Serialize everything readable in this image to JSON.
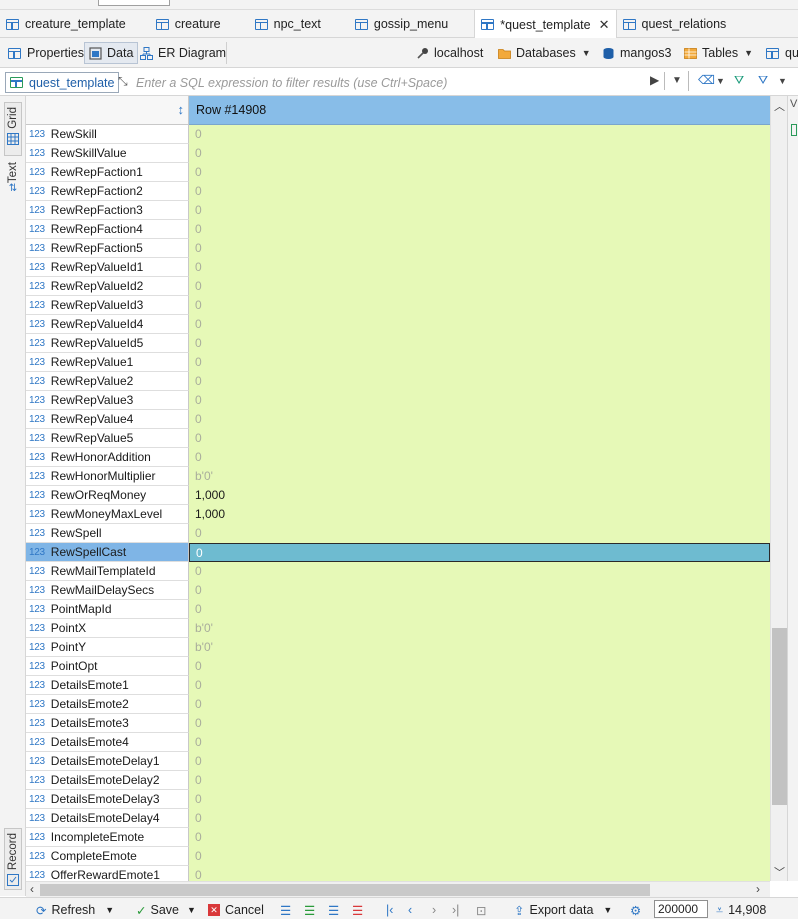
{
  "editor_tabs": [
    {
      "label": "creature_template",
      "active": false
    },
    {
      "label": "creature",
      "active": false
    },
    {
      "label": "npc_text",
      "active": false
    },
    {
      "label": "gossip_menu",
      "active": false
    },
    {
      "label": "*quest_template",
      "active": true
    },
    {
      "label": "quest_relations",
      "active": false
    }
  ],
  "subtoolbar": {
    "properties": "Properties",
    "data": "Data",
    "er_diagram": "ER Diagram",
    "connection": "localhost",
    "databases": "Databases",
    "schema": "mangos3",
    "tables": "Tables",
    "cut_label": "qu"
  },
  "filter": {
    "table": "quest_template",
    "placeholder": "Enter a SQL expression to filter results (use Ctrl+Space)"
  },
  "side_tabs": {
    "grid": "Grid",
    "text": "Text",
    "record": "Record"
  },
  "grid": {
    "header": "Row  #14908",
    "type_badge": "123",
    "selected_index": 22,
    "rows": [
      {
        "name": "RewSkill",
        "value": "0"
      },
      {
        "name": "RewSkillValue",
        "value": "0"
      },
      {
        "name": "RewRepFaction1",
        "value": "0"
      },
      {
        "name": "RewRepFaction2",
        "value": "0"
      },
      {
        "name": "RewRepFaction3",
        "value": "0"
      },
      {
        "name": "RewRepFaction4",
        "value": "0"
      },
      {
        "name": "RewRepFaction5",
        "value": "0"
      },
      {
        "name": "RewRepValueId1",
        "value": "0"
      },
      {
        "name": "RewRepValueId2",
        "value": "0"
      },
      {
        "name": "RewRepValueId3",
        "value": "0"
      },
      {
        "name": "RewRepValueId4",
        "value": "0"
      },
      {
        "name": "RewRepValueId5",
        "value": "0"
      },
      {
        "name": "RewRepValue1",
        "value": "0"
      },
      {
        "name": "RewRepValue2",
        "value": "0"
      },
      {
        "name": "RewRepValue3",
        "value": "0"
      },
      {
        "name": "RewRepValue4",
        "value": "0"
      },
      {
        "name": "RewRepValue5",
        "value": "0"
      },
      {
        "name": "RewHonorAddition",
        "value": "0"
      },
      {
        "name": "RewHonorMultiplier",
        "value": "b'0'"
      },
      {
        "name": "RewOrReqMoney",
        "value": "1,000",
        "strong": true
      },
      {
        "name": "RewMoneyMaxLevel",
        "value": "1,000",
        "strong": true
      },
      {
        "name": "RewSpell",
        "value": "0"
      },
      {
        "name": "RewSpellCast",
        "value": "0"
      },
      {
        "name": "RewMailTemplateId",
        "value": "0"
      },
      {
        "name": "RewMailDelaySecs",
        "value": "0"
      },
      {
        "name": "PointMapId",
        "value": "0"
      },
      {
        "name": "PointX",
        "value": "b'0'"
      },
      {
        "name": "PointY",
        "value": "b'0'"
      },
      {
        "name": "PointOpt",
        "value": "0"
      },
      {
        "name": "DetailsEmote1",
        "value": "0"
      },
      {
        "name": "DetailsEmote2",
        "value": "0"
      },
      {
        "name": "DetailsEmote3",
        "value": "0"
      },
      {
        "name": "DetailsEmote4",
        "value": "0"
      },
      {
        "name": "DetailsEmoteDelay1",
        "value": "0"
      },
      {
        "name": "DetailsEmoteDelay2",
        "value": "0"
      },
      {
        "name": "DetailsEmoteDelay3",
        "value": "0"
      },
      {
        "name": "DetailsEmoteDelay4",
        "value": "0"
      },
      {
        "name": "IncompleteEmote",
        "value": "0"
      },
      {
        "name": "CompleteEmote",
        "value": "0"
      },
      {
        "name": "OfferRewardEmote1",
        "value": "0"
      }
    ]
  },
  "bottombar": {
    "refresh": "Refresh",
    "save": "Save",
    "cancel": "Cancel",
    "export": "Export data",
    "limit": "200000",
    "row_count": "14,908"
  },
  "colors": {
    "value_cell_bg": "#e6f9b7",
    "header_bg": "#88bde8",
    "selected_name_bg": "#7fb5e6",
    "selected_value_bg": "#6ebbd0",
    "accent": "#2f77c5"
  }
}
